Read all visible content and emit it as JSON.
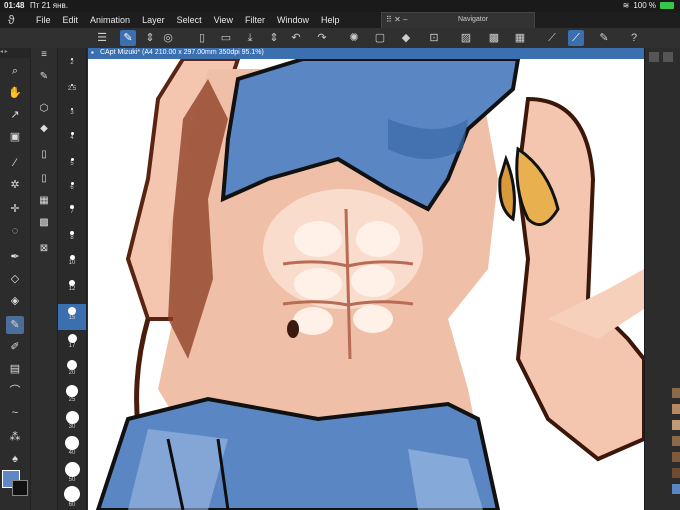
{
  "status": {
    "time": "01:48",
    "date": "Пт 21 янв.",
    "battery": "100 %"
  },
  "menu": [
    "File",
    "Edit",
    "Animation",
    "Layer",
    "Select",
    "View",
    "Filter",
    "Window",
    "Help"
  ],
  "navigator": {
    "title": "Navigator"
  },
  "document": {
    "title": "CApt Mizuki* (A4 210.00 x 297.00mm 350dpi 95.1%)"
  },
  "brush_sizes": [
    "2",
    "2.5",
    "3",
    "4",
    "5",
    "6",
    "7",
    "8",
    "10",
    "12",
    "15",
    "17",
    "20",
    "25",
    "30",
    "40",
    "50",
    "60"
  ],
  "selected_brush_size": "15",
  "colors": {
    "main": "#5d88c5",
    "sub": "#111111",
    "accent": "#3a6fb0"
  }
}
